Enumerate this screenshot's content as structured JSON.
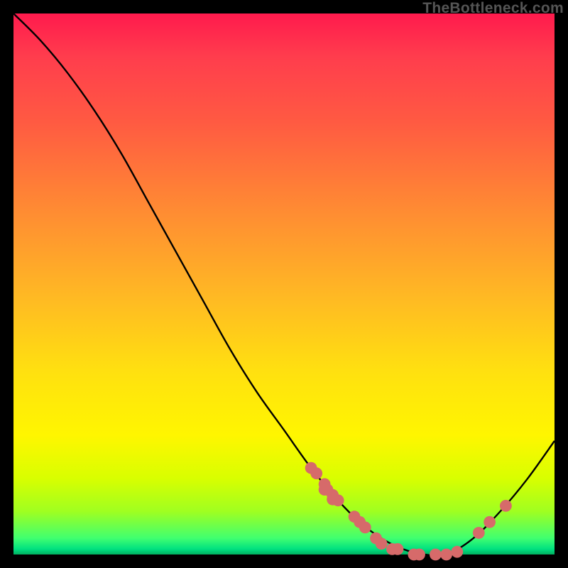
{
  "watermark": "TheBottleneck.com",
  "chart_data": {
    "type": "line",
    "title": "",
    "xlabel": "",
    "ylabel": "",
    "xlim": [
      0,
      100
    ],
    "ylim": [
      0,
      100
    ],
    "curve": {
      "x": [
        0,
        5,
        10,
        15,
        20,
        25,
        30,
        35,
        40,
        45,
        50,
        55,
        60,
        64,
        68,
        72,
        76,
        80,
        85,
        90,
        95,
        100
      ],
      "y_down": [
        0,
        5,
        11,
        18,
        26,
        35,
        44,
        53,
        62,
        70,
        77,
        84,
        90,
        94,
        97,
        99,
        100,
        100,
        97,
        92,
        86,
        79
      ],
      "note": "y_down is distance from top edge as a percentage (0 = top, 100 = bottom). The curve descends steeply from top-left, bottoms out around x≈75 near the floor, then rises toward the right edge."
    },
    "points": {
      "color": "#d66a6a",
      "radius_pct": 1.1,
      "x": [
        55,
        56,
        57.5,
        57.5,
        58,
        59,
        59,
        60,
        63,
        64,
        65,
        67,
        68,
        70,
        71,
        74,
        75,
        78,
        80,
        82,
        86,
        88,
        91
      ],
      "y_down": [
        84,
        85,
        87,
        88,
        88,
        89,
        89.8,
        90,
        93,
        94,
        95,
        97,
        98,
        99,
        99,
        100,
        100,
        100,
        100,
        99.5,
        96,
        94,
        91
      ]
    }
  }
}
